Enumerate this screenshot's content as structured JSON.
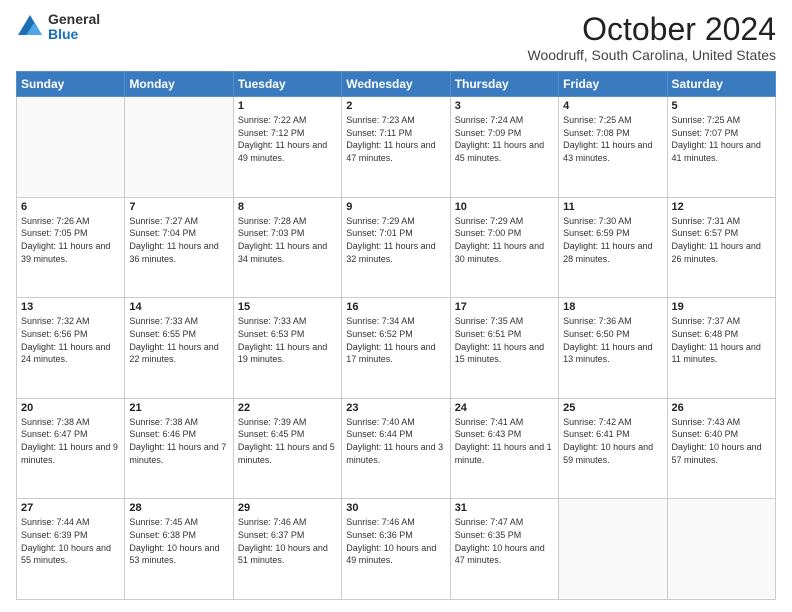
{
  "logo": {
    "general": "General",
    "blue": "Blue"
  },
  "header": {
    "month": "October 2024",
    "location": "Woodruff, South Carolina, United States"
  },
  "weekdays": [
    "Sunday",
    "Monday",
    "Tuesday",
    "Wednesday",
    "Thursday",
    "Friday",
    "Saturday"
  ],
  "weeks": [
    [
      {
        "day": "",
        "info": ""
      },
      {
        "day": "",
        "info": ""
      },
      {
        "day": "1",
        "info": "Sunrise: 7:22 AM\nSunset: 7:12 PM\nDaylight: 11 hours and 49 minutes."
      },
      {
        "day": "2",
        "info": "Sunrise: 7:23 AM\nSunset: 7:11 PM\nDaylight: 11 hours and 47 minutes."
      },
      {
        "day": "3",
        "info": "Sunrise: 7:24 AM\nSunset: 7:09 PM\nDaylight: 11 hours and 45 minutes."
      },
      {
        "day": "4",
        "info": "Sunrise: 7:25 AM\nSunset: 7:08 PM\nDaylight: 11 hours and 43 minutes."
      },
      {
        "day": "5",
        "info": "Sunrise: 7:25 AM\nSunset: 7:07 PM\nDaylight: 11 hours and 41 minutes."
      }
    ],
    [
      {
        "day": "6",
        "info": "Sunrise: 7:26 AM\nSunset: 7:05 PM\nDaylight: 11 hours and 39 minutes."
      },
      {
        "day": "7",
        "info": "Sunrise: 7:27 AM\nSunset: 7:04 PM\nDaylight: 11 hours and 36 minutes."
      },
      {
        "day": "8",
        "info": "Sunrise: 7:28 AM\nSunset: 7:03 PM\nDaylight: 11 hours and 34 minutes."
      },
      {
        "day": "9",
        "info": "Sunrise: 7:29 AM\nSunset: 7:01 PM\nDaylight: 11 hours and 32 minutes."
      },
      {
        "day": "10",
        "info": "Sunrise: 7:29 AM\nSunset: 7:00 PM\nDaylight: 11 hours and 30 minutes."
      },
      {
        "day": "11",
        "info": "Sunrise: 7:30 AM\nSunset: 6:59 PM\nDaylight: 11 hours and 28 minutes."
      },
      {
        "day": "12",
        "info": "Sunrise: 7:31 AM\nSunset: 6:57 PM\nDaylight: 11 hours and 26 minutes."
      }
    ],
    [
      {
        "day": "13",
        "info": "Sunrise: 7:32 AM\nSunset: 6:56 PM\nDaylight: 11 hours and 24 minutes."
      },
      {
        "day": "14",
        "info": "Sunrise: 7:33 AM\nSunset: 6:55 PM\nDaylight: 11 hours and 22 minutes."
      },
      {
        "day": "15",
        "info": "Sunrise: 7:33 AM\nSunset: 6:53 PM\nDaylight: 11 hours and 19 minutes."
      },
      {
        "day": "16",
        "info": "Sunrise: 7:34 AM\nSunset: 6:52 PM\nDaylight: 11 hours and 17 minutes."
      },
      {
        "day": "17",
        "info": "Sunrise: 7:35 AM\nSunset: 6:51 PM\nDaylight: 11 hours and 15 minutes."
      },
      {
        "day": "18",
        "info": "Sunrise: 7:36 AM\nSunset: 6:50 PM\nDaylight: 11 hours and 13 minutes."
      },
      {
        "day": "19",
        "info": "Sunrise: 7:37 AM\nSunset: 6:48 PM\nDaylight: 11 hours and 11 minutes."
      }
    ],
    [
      {
        "day": "20",
        "info": "Sunrise: 7:38 AM\nSunset: 6:47 PM\nDaylight: 11 hours and 9 minutes."
      },
      {
        "day": "21",
        "info": "Sunrise: 7:38 AM\nSunset: 6:46 PM\nDaylight: 11 hours and 7 minutes."
      },
      {
        "day": "22",
        "info": "Sunrise: 7:39 AM\nSunset: 6:45 PM\nDaylight: 11 hours and 5 minutes."
      },
      {
        "day": "23",
        "info": "Sunrise: 7:40 AM\nSunset: 6:44 PM\nDaylight: 11 hours and 3 minutes."
      },
      {
        "day": "24",
        "info": "Sunrise: 7:41 AM\nSunset: 6:43 PM\nDaylight: 11 hours and 1 minute."
      },
      {
        "day": "25",
        "info": "Sunrise: 7:42 AM\nSunset: 6:41 PM\nDaylight: 10 hours and 59 minutes."
      },
      {
        "day": "26",
        "info": "Sunrise: 7:43 AM\nSunset: 6:40 PM\nDaylight: 10 hours and 57 minutes."
      }
    ],
    [
      {
        "day": "27",
        "info": "Sunrise: 7:44 AM\nSunset: 6:39 PM\nDaylight: 10 hours and 55 minutes."
      },
      {
        "day": "28",
        "info": "Sunrise: 7:45 AM\nSunset: 6:38 PM\nDaylight: 10 hours and 53 minutes."
      },
      {
        "day": "29",
        "info": "Sunrise: 7:46 AM\nSunset: 6:37 PM\nDaylight: 10 hours and 51 minutes."
      },
      {
        "day": "30",
        "info": "Sunrise: 7:46 AM\nSunset: 6:36 PM\nDaylight: 10 hours and 49 minutes."
      },
      {
        "day": "31",
        "info": "Sunrise: 7:47 AM\nSunset: 6:35 PM\nDaylight: 10 hours and 47 minutes."
      },
      {
        "day": "",
        "info": ""
      },
      {
        "day": "",
        "info": ""
      }
    ]
  ]
}
